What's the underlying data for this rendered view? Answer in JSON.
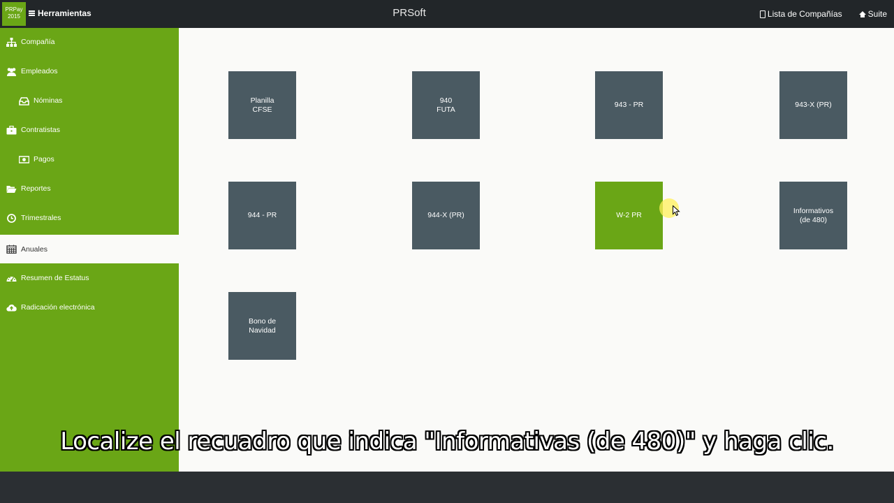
{
  "header": {
    "logo_line1": "PRPay",
    "logo_line2": "2015",
    "tools_label": "Herramientas",
    "app_title": "PRSoft",
    "companies_label": "Lista de Compañías",
    "suite_label": "Suite"
  },
  "sidebar": {
    "items": [
      {
        "label": "Compañía",
        "icon": "sitemap-icon"
      },
      {
        "label": "Empleados",
        "icon": "users-icon"
      },
      {
        "label": "Nóminas",
        "icon": "inbox-icon"
      },
      {
        "label": "Contratistas",
        "icon": "briefcase-icon"
      },
      {
        "label": "Pagos",
        "icon": "money-icon"
      },
      {
        "label": "Reportes",
        "icon": "folder-open-icon"
      },
      {
        "label": "Trimestrales",
        "icon": "clock-icon"
      },
      {
        "label": "Anuales",
        "icon": "calendar-icon"
      },
      {
        "label": "Resumen de Estatus",
        "icon": "dashboard-icon"
      },
      {
        "label": "Radicación electrónica",
        "icon": "cloud-upload-icon"
      }
    ],
    "active": "Anuales"
  },
  "tiles": [
    {
      "label": "Planilla\nCFSE"
    },
    {
      "label": "940\nFUTA"
    },
    {
      "label": "943 - PR"
    },
    {
      "label": "943-X (PR)"
    },
    {
      "label": "944 - PR"
    },
    {
      "label": "944-X (PR)"
    },
    {
      "label": "W-2 PR"
    },
    {
      "label": "Informativos\n(de 480)"
    },
    {
      "label": "Bono de\nNavidad"
    }
  ],
  "active_tile": "W-2 PR",
  "caption": "Localize el recuadro que indica \"Informativas (de 480)\" y haga clic.",
  "colors": {
    "brand_green": "#6aa616",
    "tile_gray": "#4a5a62",
    "topbar": "#222629"
  }
}
